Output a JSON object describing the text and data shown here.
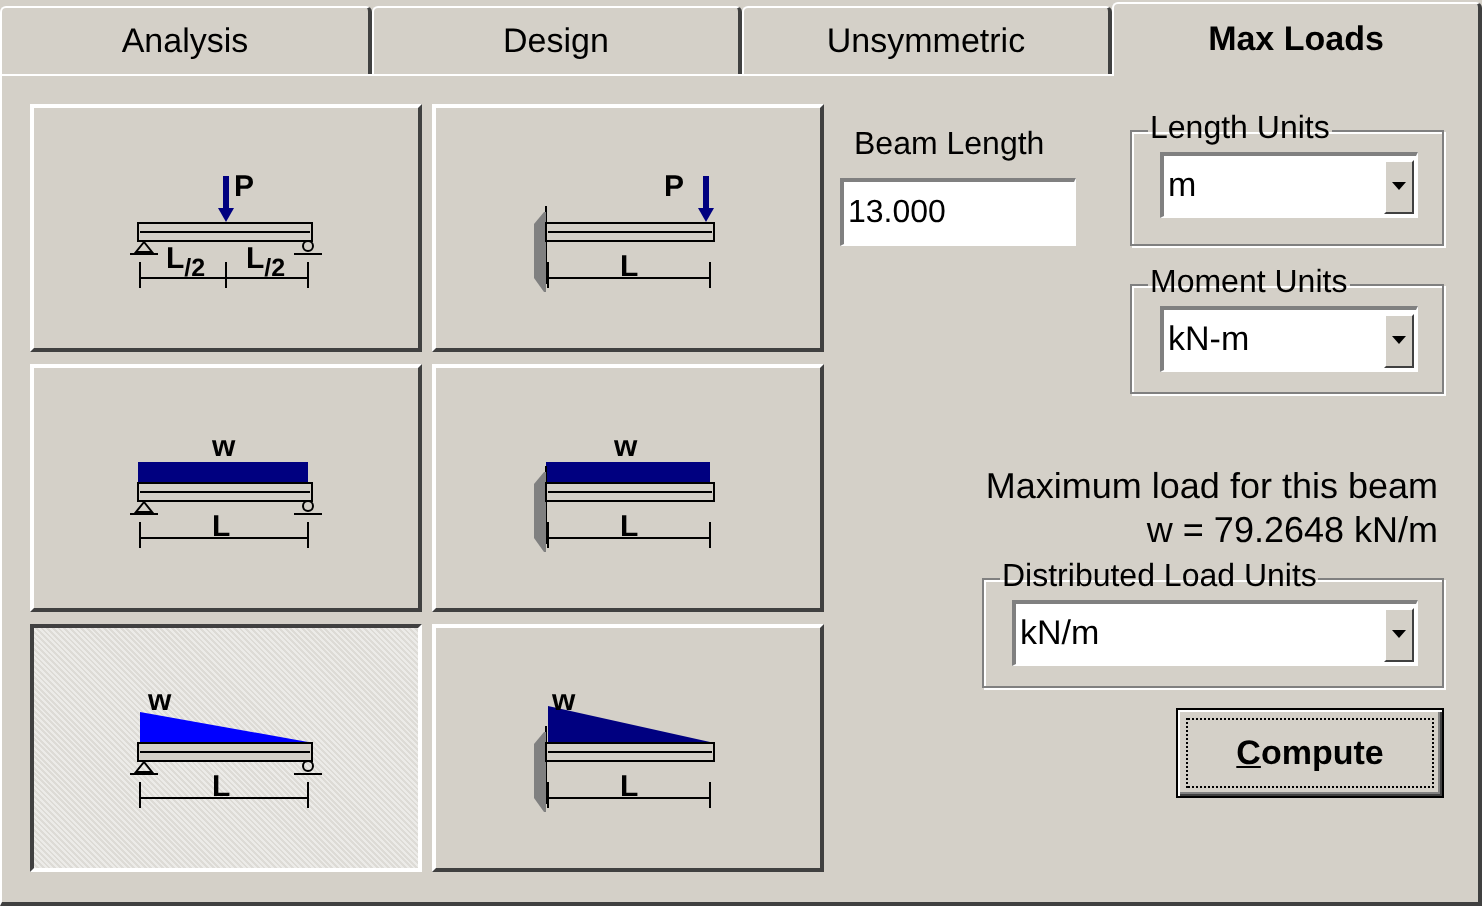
{
  "tabs": [
    {
      "label": "Analysis",
      "selected": false
    },
    {
      "label": "Design",
      "selected": false
    },
    {
      "label": "Unsymmetric",
      "selected": false
    },
    {
      "label": "Max Loads",
      "selected": true
    }
  ],
  "load_cases": [
    {
      "load": {
        "kind": "point"
      },
      "support": {
        "kind": "simple"
      },
      "selected": false,
      "load_label": "P",
      "span_labels": [
        "L$_{/2}$",
        "L$_{/2}$"
      ]
    },
    {
      "load": {
        "kind": "point"
      },
      "support": {
        "kind": "cantilever"
      },
      "selected": false,
      "load_label": "P",
      "span_labels": [
        "L"
      ]
    },
    {
      "load": {
        "kind": "uniform"
      },
      "support": {
        "kind": "simple"
      },
      "selected": false,
      "load_label": "w",
      "span_labels": [
        "L"
      ]
    },
    {
      "load": {
        "kind": "uniform"
      },
      "support": {
        "kind": "cantilever"
      },
      "selected": false,
      "load_label": "w",
      "span_labels": [
        "L"
      ]
    },
    {
      "load": {
        "kind": "triangular"
      },
      "support": {
        "kind": "simple"
      },
      "selected": true,
      "load_label": "w",
      "span_labels": [
        "L"
      ]
    },
    {
      "load": {
        "kind": "triangular"
      },
      "support": {
        "kind": "cantilever"
      },
      "selected": false,
      "load_label": "w",
      "span_labels": [
        "L"
      ]
    }
  ],
  "beam_length": {
    "label": "Beam Length",
    "value": "13.000"
  },
  "length_units": {
    "label": "Length Units",
    "value": "m"
  },
  "moment_units": {
    "label": "Moment Units",
    "value": "kN-m"
  },
  "result": {
    "heading": "Maximum load for this beam",
    "value": "w = 79.2648 kN/m"
  },
  "distributed_load_units": {
    "label": "Distributed Load Units",
    "value": "kN/m"
  },
  "compute_button": "Compute"
}
